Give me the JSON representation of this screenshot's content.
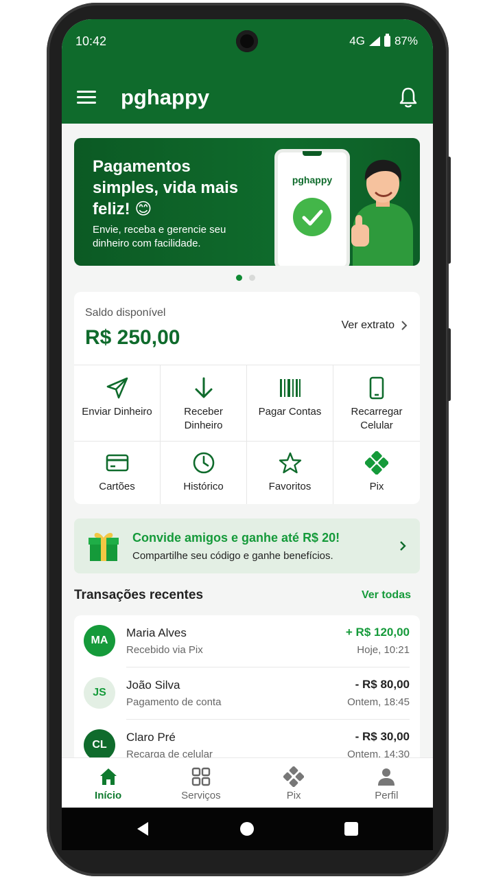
{
  "status_bar": {
    "time": "10:42",
    "network": "4G",
    "battery": "87%"
  },
  "app": {
    "title": "pghappy"
  },
  "banner": {
    "headline": "Pagamentos simples, vida mais feliz! 😊",
    "subtitle": "Envie, receba e gerencie seu dinheiro com facilidade.",
    "mock_brand": "pghappy",
    "active_slide": 1,
    "slide_count": 2
  },
  "balance": {
    "label": "Saldo disponível",
    "value": "R$ 250,00",
    "statement_link": "Ver extrato"
  },
  "actions": [
    {
      "label": "Enviar Dinheiro",
      "icon": "send-icon"
    },
    {
      "label": "Receber Dinheiro",
      "icon": "arrow-down-icon"
    },
    {
      "label": "Pagar Contas",
      "icon": "barcode-icon"
    },
    {
      "label": "Recarregar Celular",
      "icon": "smartphone-icon"
    },
    {
      "label": "Cartões",
      "icon": "card-icon"
    },
    {
      "label": "Histórico",
      "icon": "clock-icon"
    },
    {
      "label": "Favoritos",
      "icon": "star-icon"
    },
    {
      "label": "Pix",
      "icon": "pix-icon"
    }
  ],
  "invite": {
    "title": "Convide amigos e ganhe até R$ 20!",
    "subtitle": "Compartilhe seu código e ganhe benefícios."
  },
  "transactions": {
    "title": "Transações recentes",
    "see_all": "Ver todas",
    "items": [
      {
        "initials": "MA",
        "name": "Maria Alves",
        "description": "Recebido via Pix",
        "amount": "+ R$ 120,00",
        "time": "Hoje, 10:21"
      },
      {
        "initials": "JS",
        "name": "João Silva",
        "description": "Pagamento de conta",
        "amount": "- R$ 80,00",
        "time": "Ontem, 18:45"
      },
      {
        "initials": "CL",
        "name": "Claro Pré",
        "description": "Recarga de celular",
        "amount": "- R$ 30,00",
        "time": "Ontem, 14:30"
      }
    ]
  },
  "tabs": [
    {
      "label": "Início",
      "icon": "home-icon",
      "active": true
    },
    {
      "label": "Serviços",
      "icon": "grid-icon",
      "active": false
    },
    {
      "label": "Pix",
      "icon": "pix-icon",
      "active": false
    },
    {
      "label": "Perfil",
      "icon": "user-icon",
      "active": false
    }
  ],
  "colors": {
    "primary": "#0f6b2c",
    "accent": "#159a3a",
    "invite_bg": "#e3efe4"
  }
}
